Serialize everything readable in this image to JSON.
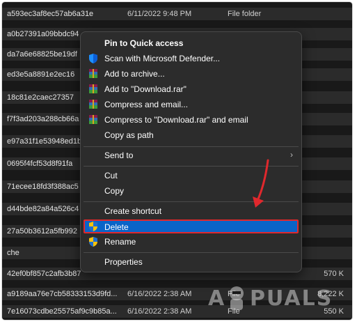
{
  "files": [
    {
      "name": "a593ec3af8ec57ab6a31e",
      "date": "6/11/2022 9:48 PM",
      "type": "File folder",
      "size": ""
    },
    {
      "name": "a0b27391a09bbdc94",
      "date": "",
      "type": "",
      "size": ""
    },
    {
      "name": "da7a6e68825be19df",
      "date": "",
      "type": "",
      "size": ""
    },
    {
      "name": "ed3e5a8891e2ec16",
      "date": "",
      "type": "",
      "size": ""
    },
    {
      "name": "18c81e2caec27357",
      "date": "",
      "type": "",
      "size": ""
    },
    {
      "name": "f7f3ad203a288cb66a",
      "date": "",
      "type": "",
      "size": ""
    },
    {
      "name": "e97a31f1e53948ed1b",
      "date": "",
      "type": "",
      "size": ""
    },
    {
      "name": "0695f4fcf53d8f91fa",
      "date": "",
      "type": "",
      "size": ""
    },
    {
      "name": "71ecee18fd3f388ac5",
      "date": "",
      "type": "",
      "size": ""
    },
    {
      "name": "d44bde82a84a526c4",
      "date": "",
      "type": "",
      "size": ""
    },
    {
      "name": "27a50b3612a5fb992",
      "date": "",
      "type": "",
      "size": ""
    },
    {
      "name": "che",
      "date": "",
      "type": "",
      "size": ""
    },
    {
      "name": "42ef0bf857c2afb3b87",
      "date": "",
      "type": "",
      "size": "570 K"
    },
    {
      "name": "a9189aa76e7cb58333153d9fd...",
      "date": "6/16/2022 2:38 AM",
      "type": "File",
      "size": "8,222 K"
    },
    {
      "name": "7e16073cdbe25575af9c9b85a...",
      "date": "6/16/2022 2:38 AM",
      "type": "File",
      "size": "550 K"
    }
  ],
  "context_menu": {
    "items": [
      {
        "label": "Pin to Quick access",
        "icon": "pin-icon",
        "bold": true
      },
      {
        "label": "Scan with Microsoft Defender...",
        "icon": "defender-shield-icon"
      },
      {
        "label": "Add to archive...",
        "icon": "winrar-icon"
      },
      {
        "label": "Add to \"Download.rar\"",
        "icon": "winrar-icon"
      },
      {
        "label": "Compress and email...",
        "icon": "winrar-icon"
      },
      {
        "label": "Compress to \"Download.rar\" and email",
        "icon": "winrar-icon"
      },
      {
        "label": "Copy as path",
        "icon": ""
      },
      {
        "label": "Send to",
        "icon": "",
        "submenu": true
      },
      {
        "label": "Cut",
        "icon": ""
      },
      {
        "label": "Copy",
        "icon": ""
      },
      {
        "label": "Create shortcut",
        "icon": ""
      },
      {
        "label": "Delete",
        "icon": "uac-shield-icon",
        "selected": true
      },
      {
        "label": "Rename",
        "icon": "uac-shield-icon"
      },
      {
        "label": "Properties",
        "icon": ""
      }
    ],
    "submenu_glyph": "›"
  },
  "watermark": {
    "text": "A PUALS",
    "left_letter": "A",
    "right_letters": "PUALS"
  },
  "colors": {
    "selection": "#0a64c8",
    "highlight_border": "#e0282d",
    "arrow": "#e0282d",
    "menu_bg": "#2c2c2c"
  }
}
